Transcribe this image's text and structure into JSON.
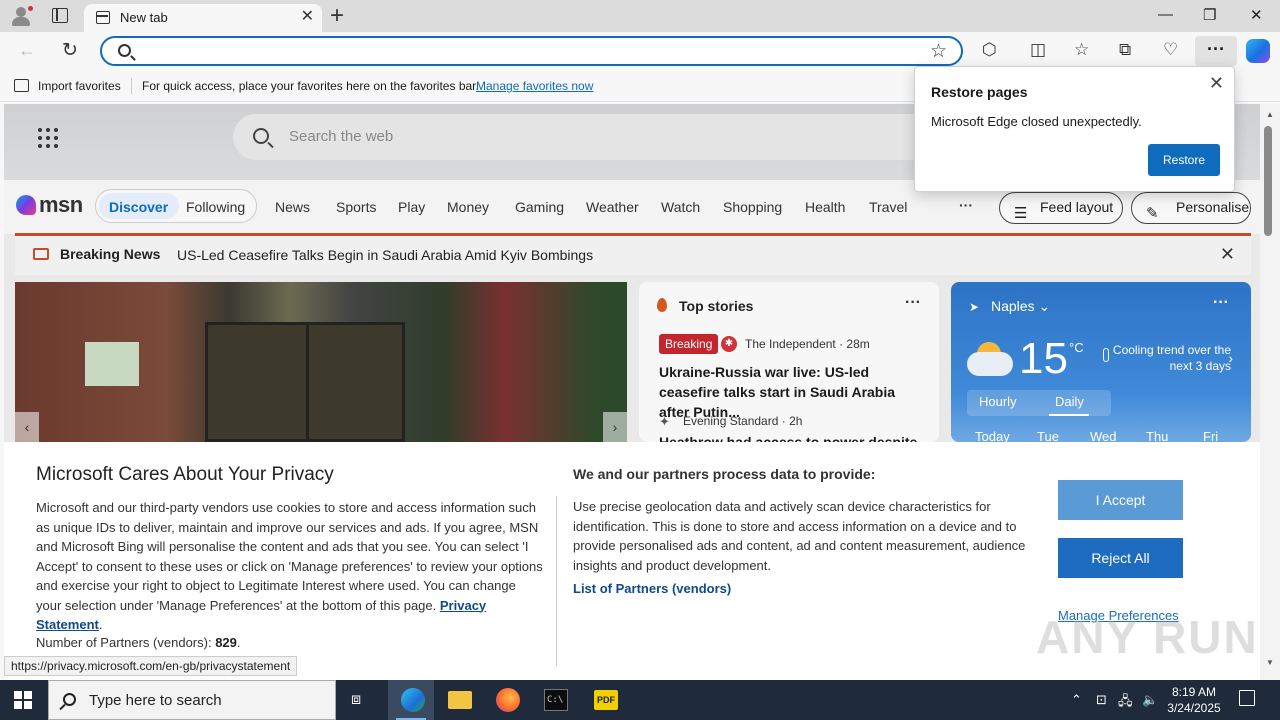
{
  "browser": {
    "tab_title": "New tab",
    "tab_close": "✕",
    "new_tab": "+",
    "window_controls": {
      "minimize": "—",
      "maximize": "❐",
      "close": "✕"
    },
    "address_placeholder": "",
    "favorites_bar": {
      "import_label": "Import favorites",
      "message": "For quick access, place your favorites here on the favorites bar.",
      "manage_link": "Manage favorites now"
    },
    "more_button": "···",
    "status_url": "https://privacy.microsoft.com/en-gb/privacystatement"
  },
  "restore_popup": {
    "title": "Restore pages",
    "message": "Microsoft Edge closed unexpectedly.",
    "button": "Restore",
    "close": "✕"
  },
  "msn": {
    "search_placeholder": "Search the web",
    "logo_text": "msn",
    "pills": [
      "Discover",
      "Following"
    ],
    "nav": [
      "News",
      "Sports",
      "Play",
      "Money",
      "Gaming",
      "Weather",
      "Watch",
      "Shopping",
      "Health",
      "Travel"
    ],
    "nav_more": "···",
    "feed_layout": "Feed layout",
    "personalise": "Personalise",
    "breaking": {
      "label": "Breaking News",
      "text": "US-Led Ceasefire Talks Begin in Saudi Arabia Amid Kyiv Bombings",
      "close": "✕"
    },
    "top_stories": {
      "title": "Top stories",
      "more": "···",
      "items": [
        {
          "badge": "Breaking",
          "source": "The Independent · 28m",
          "headline": "Ukraine-Russia war live: US-led ceasefire talks start in Saudi Arabia after Putin..."
        },
        {
          "source": "Evening Standard · 2h",
          "headline": "Heathrow had access to power despite"
        }
      ]
    },
    "weather": {
      "location": "Naples",
      "temp": "15",
      "unit": "°C",
      "trend": "Cooling trend over the next 3 days",
      "tabs": [
        "Hourly",
        "Daily"
      ],
      "days": [
        "Today",
        "Tue",
        "Wed",
        "Thu",
        "Fri"
      ],
      "more": "···"
    }
  },
  "privacy": {
    "title": "Microsoft Cares About Your Privacy",
    "body": "Microsoft and our third-party vendors use cookies to store and access information such as unique IDs to deliver, maintain and improve our services and ads. If you agree, MSN and Microsoft Bing will personalise the content and ads that you see. You can select 'I Accept' to consent to these uses or click on 'Manage preferences' to review your options and exercise your right to object to Legitimate Interest where used.  You can change your selection under 'Manage Preferences' at the bottom of this page.",
    "privacy_link": "Privacy Statement",
    "partners_label": "Number of Partners (vendors):",
    "partners_count": "829",
    "heading2": "We and our partners process data to provide:",
    "body2": "Use precise geolocation data and actively scan device characteristics for identification. This is done to store and access information on a device and to provide personalised ads and content, ad and content measurement, audience insights and product development.",
    "vendors_link": "List of Partners (vendors)",
    "accept": "I Accept",
    "reject": "Reject All",
    "manage": "Manage Preferences"
  },
  "watermark": "ANY RUN",
  "taskbar": {
    "search_placeholder": "Type here to search",
    "time": "8:19 AM",
    "date": "3/24/2025"
  },
  "colors": {
    "accent": "#0f6cbd",
    "breaking": "#c4262e",
    "taskbar": "#1f2a3a"
  }
}
